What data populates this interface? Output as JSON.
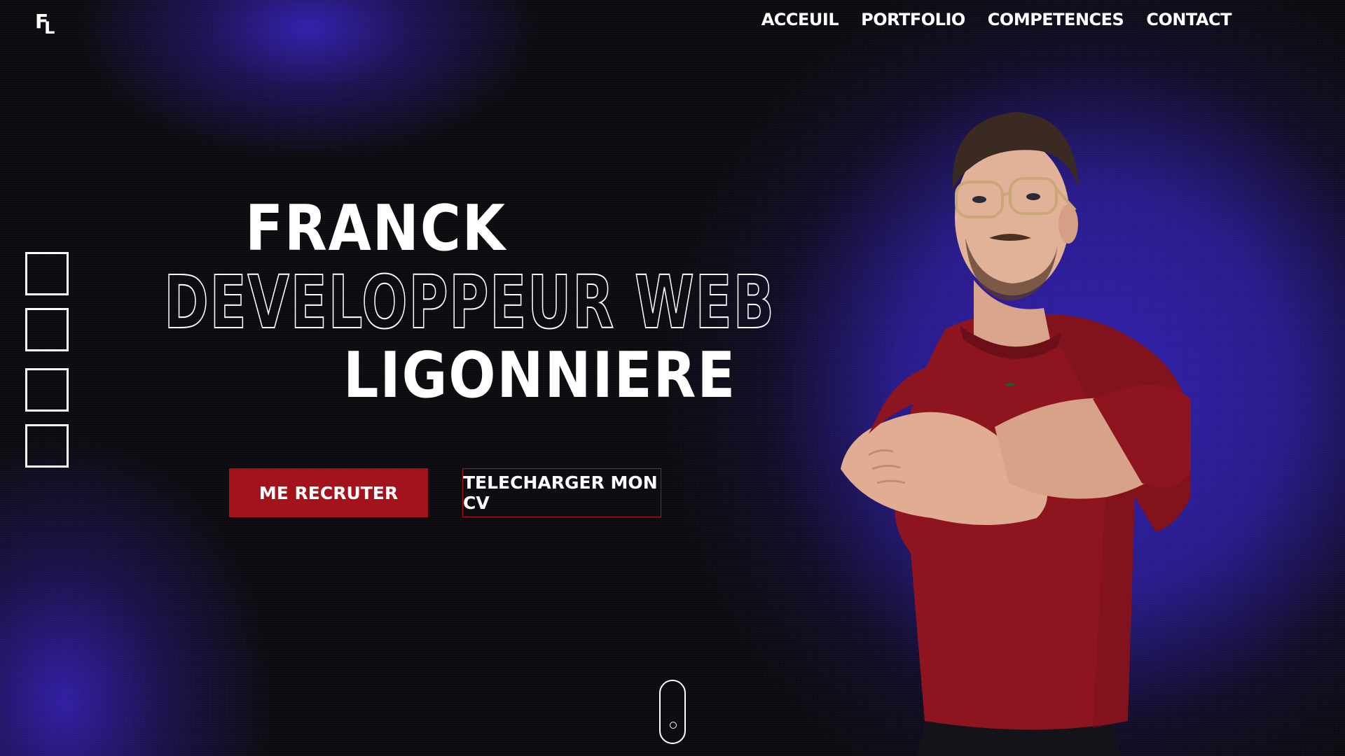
{
  "logo": {
    "first": "F",
    "second": "L"
  },
  "nav": {
    "items": [
      {
        "label": "ACCEUIL"
      },
      {
        "label": "PORTFOLIO"
      },
      {
        "label": "COMPETENCES"
      },
      {
        "label": "CONTACT"
      }
    ]
  },
  "hero": {
    "first_name": "FRANCK",
    "role": "DEVELOPPEUR WEB",
    "last_name": "LIGONNIERE"
  },
  "actions": {
    "primary_label": "ME RECRUTER",
    "secondary_label": "TELECHARGER MON CV"
  },
  "colors": {
    "background": "#0c0a0f",
    "glow": "#3220b4",
    "accent_red": "#a3131c",
    "shirt": "#8e1520",
    "text": "#ffffff"
  },
  "icons": {
    "social_slots": [
      "square-icon",
      "square-icon",
      "square-icon",
      "square-icon"
    ],
    "scroll": "mouse-scroll-icon"
  }
}
